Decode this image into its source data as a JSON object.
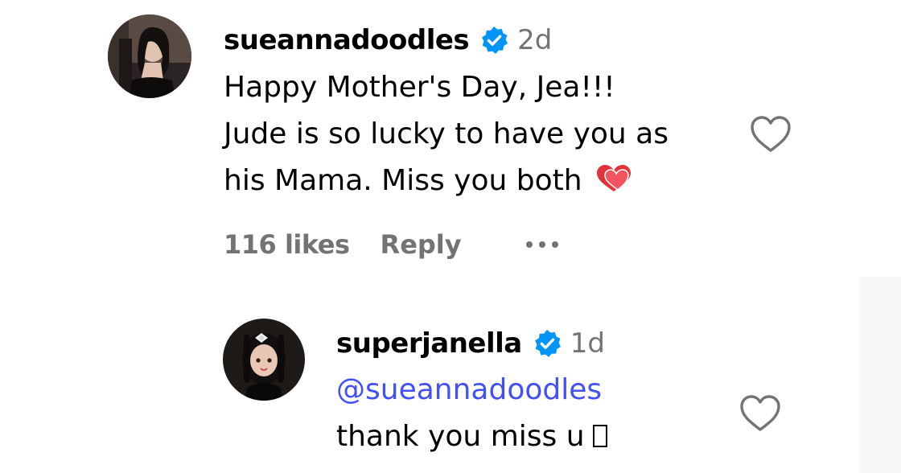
{
  "comment": {
    "username": "sueannadoodles",
    "time": "2d",
    "lines": [
      "Happy Mother's Day, Jea!!!",
      "Jude is so lucky to have you as",
      "his Mama. Miss you both"
    ],
    "likes": "116 likes",
    "reply_label": "Reply"
  },
  "reply": {
    "username": "superjanella",
    "time": "1d",
    "mention": "@sueannadoodles",
    "text": "thank you miss u"
  },
  "icons": {
    "verified": "verified-badge-icon",
    "like": "heart-outline-icon",
    "more": "more-options-icon",
    "emoji": "two-hearts-emoji-icon"
  },
  "colors": {
    "verified_blue": "#0095f6",
    "secondary_text": "#737373",
    "mention_blue": "#4150f7"
  }
}
